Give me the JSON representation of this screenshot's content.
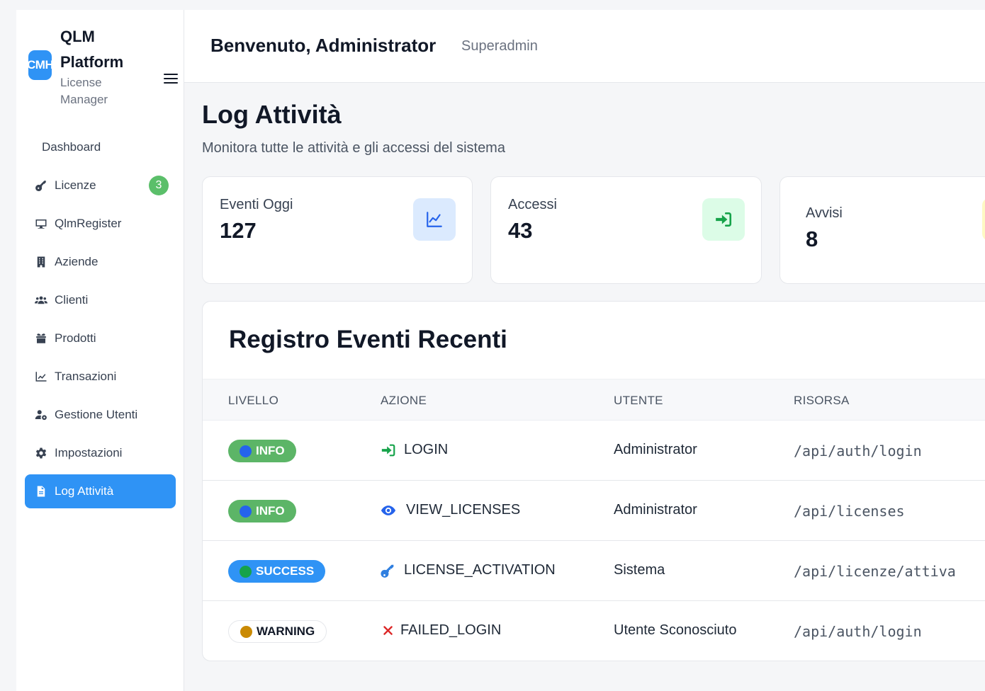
{
  "brand": {
    "logo_text": "CMH",
    "title": "QLM Platform",
    "subtitle": "License Manager",
    "menu_icon": "hamburger-icon"
  },
  "nav": {
    "items": [
      {
        "label": "Dashboard",
        "icon": "",
        "badge": ""
      },
      {
        "label": "Licenze",
        "icon": "key-icon",
        "badge": "3"
      },
      {
        "label": "QlmRegister",
        "icon": "monitor-icon",
        "badge": ""
      },
      {
        "label": "Aziende",
        "icon": "building-icon",
        "badge": ""
      },
      {
        "label": "Clienti",
        "icon": "users-icon",
        "badge": ""
      },
      {
        "label": "Prodotti",
        "icon": "box-icon",
        "badge": ""
      },
      {
        "label": "Transazioni",
        "icon": "chart-line-icon",
        "badge": ""
      },
      {
        "label": "Gestione Utenti",
        "icon": "users-cog-icon",
        "badge": ""
      },
      {
        "label": "Impostazioni",
        "icon": "gear-icon",
        "badge": ""
      },
      {
        "label": "Log Attività",
        "icon": "file-icon",
        "badge": "",
        "active": true
      }
    ]
  },
  "header": {
    "welcome": "Benvenuto, Administrator",
    "role": "Superadmin"
  },
  "page": {
    "title": "Log Attività",
    "subtitle": "Monitora tutte le attività e gli accessi del sistema"
  },
  "stats": [
    {
      "label": "Eventi Oggi",
      "value": "127",
      "icon": "chart-line-icon",
      "color": "#2563eb",
      "bg": "#dbeafe"
    },
    {
      "label": "Accessi",
      "value": "43",
      "icon": "sign-in-icon",
      "color": "#16a34a",
      "bg": "#dcfce7"
    },
    {
      "label": "Avvisi",
      "value": "8",
      "icon": "warning-icon",
      "color": "#ca8a04",
      "bg": "#fef9c3"
    }
  ],
  "events": {
    "title": "Registro Eventi Recenti",
    "columns": [
      "LIVELLO",
      "AZIONE",
      "UTENTE",
      "RISORSA"
    ],
    "rows": [
      {
        "level": "INFO",
        "level_bg": "#5cb567",
        "dot": "#2563eb",
        "action_icon": "sign-in-icon",
        "action": "LOGIN",
        "user": "Administrator",
        "resource": "/api/auth/login"
      },
      {
        "level": "INFO",
        "level_bg": "#5cb567",
        "dot": "#2563eb",
        "action_icon": "eye-icon",
        "action": "VIEW_LICENSES",
        "user": "Administrator",
        "resource": "/api/licenses"
      },
      {
        "level": "SUCCESS",
        "level_bg": "#2f93f5",
        "dot": "#16a34a",
        "action_icon": "key-icon",
        "action": "LICENSE_ACTIVATION",
        "user": "Sistema",
        "resource": "/api/licenze/attiva"
      },
      {
        "level": "WARNING",
        "level_bg": "#ffffff",
        "dot": "#ca8a04",
        "action_icon": "close-icon",
        "action": "FAILED_LOGIN",
        "user": "Utente Sconosciuto",
        "resource": "/api/auth/login"
      }
    ]
  }
}
